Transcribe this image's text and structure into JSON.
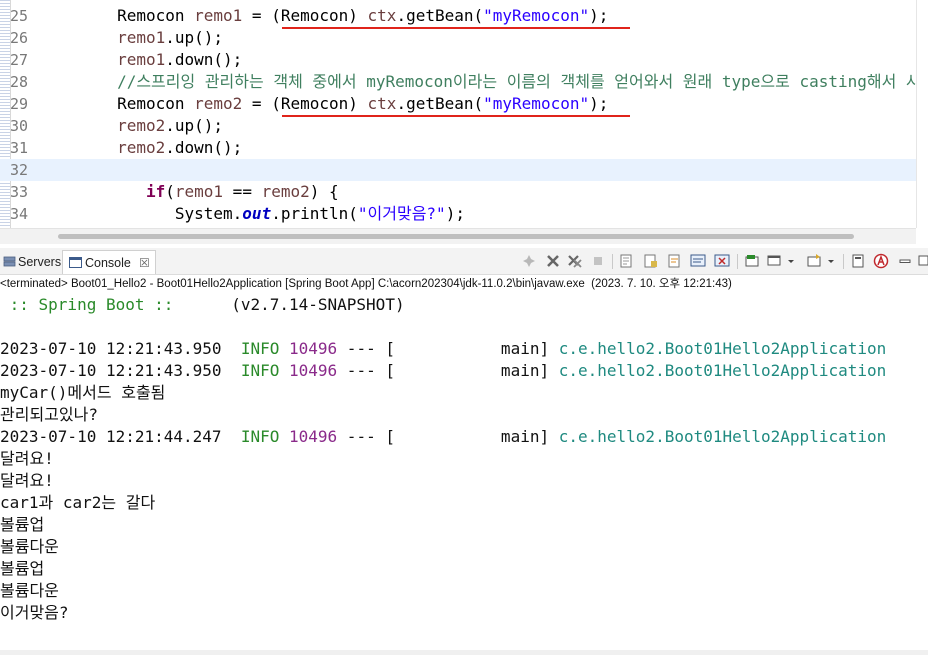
{
  "editor": {
    "lines": [
      {
        "num": "25",
        "parts": [
          {
            "t": "        Remocon ",
            "c": ""
          },
          {
            "t": "remo1",
            "c": "var"
          },
          {
            "t": " = (Remocon) ",
            "c": ""
          },
          {
            "t": "ctx",
            "c": "var"
          },
          {
            "t": ".getBean(",
            "c": ""
          },
          {
            "t": "\"myRemocon\"",
            "c": "str"
          },
          {
            "t": ");",
            "c": ""
          }
        ]
      },
      {
        "num": "26",
        "parts": [
          {
            "t": "        ",
            "c": ""
          },
          {
            "t": "remo1",
            "c": "var"
          },
          {
            "t": ".up();",
            "c": ""
          }
        ]
      },
      {
        "num": "27",
        "parts": [
          {
            "t": "        ",
            "c": ""
          },
          {
            "t": "remo1",
            "c": "var"
          },
          {
            "t": ".down();",
            "c": ""
          }
        ]
      },
      {
        "num": "28",
        "parts": [
          {
            "t": "        //스프리잉 관리하는 객체 중에서 myRemocon이라는 이름의 객체를 얻어와서 원래 type으로 casting해서 사용하",
            "c": "cmt"
          }
        ]
      },
      {
        "num": "29",
        "parts": [
          {
            "t": "        Remocon ",
            "c": ""
          },
          {
            "t": "remo2",
            "c": "var"
          },
          {
            "t": " = (Remocon) ",
            "c": ""
          },
          {
            "t": "ctx",
            "c": "var"
          },
          {
            "t": ".getBean(",
            "c": ""
          },
          {
            "t": "\"myRemocon\"",
            "c": "str"
          },
          {
            "t": ");",
            "c": ""
          }
        ]
      },
      {
        "num": "30",
        "parts": [
          {
            "t": "        ",
            "c": ""
          },
          {
            "t": "remo2",
            "c": "var"
          },
          {
            "t": ".up();",
            "c": ""
          }
        ]
      },
      {
        "num": "31",
        "parts": [
          {
            "t": "        ",
            "c": ""
          },
          {
            "t": "remo2",
            "c": "var"
          },
          {
            "t": ".down();",
            "c": ""
          }
        ]
      },
      {
        "num": "32",
        "parts": [
          {
            "t": "",
            "c": ""
          }
        ]
      },
      {
        "num": "33",
        "parts": [
          {
            "t": "           ",
            "c": ""
          },
          {
            "t": "if",
            "c": "kw"
          },
          {
            "t": "(",
            "c": ""
          },
          {
            "t": "remo1",
            "c": "var"
          },
          {
            "t": " == ",
            "c": ""
          },
          {
            "t": "remo2",
            "c": "var"
          },
          {
            "t": ") {",
            "c": ""
          }
        ]
      },
      {
        "num": "34",
        "parts": [
          {
            "t": "              System.",
            "c": ""
          },
          {
            "t": "out",
            "c": "fld"
          },
          {
            "t": ".println(",
            "c": ""
          },
          {
            "t": "\"이거맞음?\"",
            "c": "str"
          },
          {
            "t": ");",
            "c": ""
          }
        ]
      }
    ]
  },
  "console_view": {
    "tabs": [
      {
        "label": "Servers",
        "icon": "servers-icon"
      },
      {
        "label": "Console",
        "icon": "console-icon",
        "close": "☒",
        "active": true
      }
    ],
    "status": "<terminated> Boot01_Hello2 - Boot01Hello2Application [Spring Boot App] C:\\acorn202304\\jdk-11.0.2\\bin\\javaw.exe  (2023. 7. 10. 오후 12:21:43)"
  },
  "console_output": [
    [
      {
        "t": " :: Spring Boot ::",
        "c": "green"
      },
      {
        "t": "      (v2.7.14-SNAPSHOT)",
        "c": ""
      }
    ],
    [
      {
        "t": "",
        "c": ""
      }
    ],
    [
      {
        "t": "2023-07-10 12:21:43.950  ",
        "c": ""
      },
      {
        "t": "INFO",
        "c": "green"
      },
      {
        "t": " ",
        "c": ""
      },
      {
        "t": "10496",
        "c": "purple"
      },
      {
        "t": " --- [           main] ",
        "c": ""
      },
      {
        "t": "c.e.hello2.Boot01Hello2Application",
        "c": "teal"
      }
    ],
    [
      {
        "t": "2023-07-10 12:21:43.950  ",
        "c": ""
      },
      {
        "t": "INFO",
        "c": "green"
      },
      {
        "t": " ",
        "c": ""
      },
      {
        "t": "10496",
        "c": "purple"
      },
      {
        "t": " --- [           main] ",
        "c": ""
      },
      {
        "t": "c.e.hello2.Boot01Hello2Application",
        "c": "teal"
      }
    ],
    [
      {
        "t": "myCar()메서드 호출됨",
        "c": ""
      }
    ],
    [
      {
        "t": "관리되고있나?",
        "c": ""
      }
    ],
    [
      {
        "t": "2023-07-10 12:21:44.247  ",
        "c": ""
      },
      {
        "t": "INFO",
        "c": "green"
      },
      {
        "t": " ",
        "c": ""
      },
      {
        "t": "10496",
        "c": "purple"
      },
      {
        "t": " --- [           main] ",
        "c": ""
      },
      {
        "t": "c.e.hello2.Boot01Hello2Application",
        "c": "teal"
      }
    ],
    [
      {
        "t": "달려요!",
        "c": ""
      }
    ],
    [
      {
        "t": "달려요!",
        "c": ""
      }
    ],
    [
      {
        "t": "car1과 car2는 갈다",
        "c": ""
      }
    ],
    [
      {
        "t": "볼륨업",
        "c": ""
      }
    ],
    [
      {
        "t": "볼륨다운",
        "c": ""
      }
    ],
    [
      {
        "t": "볼륨업",
        "c": ""
      }
    ],
    [
      {
        "t": "볼륨다운",
        "c": ""
      }
    ],
    [
      {
        "t": "이거맞음?",
        "c": ""
      }
    ]
  ],
  "colors": {
    "keyword": "#7f0055",
    "string": "#2a00ff",
    "variable": "#6a3e3e",
    "comment": "#3f7f5f",
    "annotation_underline": "#e0241b",
    "current_line": "#e8f2fe"
  }
}
